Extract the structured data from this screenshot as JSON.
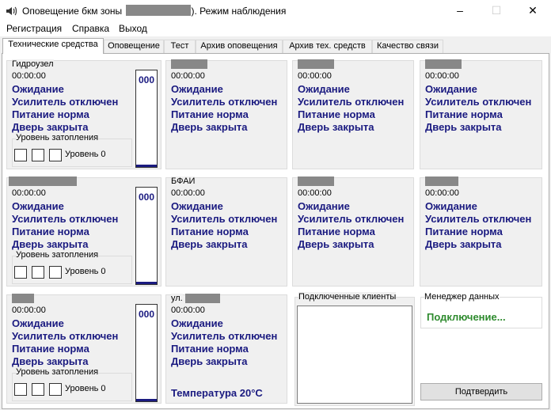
{
  "window": {
    "title_prefix": "Оповещение бкм зоны",
    "title_suffix": "). Режим наблюдения",
    "minimize_glyph": "–",
    "maximize_glyph": "☐",
    "close_glyph": "✕"
  },
  "menu": [
    "Регистрация",
    "Справка",
    "Выход"
  ],
  "tabs": [
    "Технические средства",
    "Оповещение",
    "Тест",
    "Архив оповещения",
    "Архив тех. средств",
    "Качество связи"
  ],
  "active_tab": 0,
  "common": {
    "time": "00:00:00",
    "status_wait": "Ожидание",
    "status_amp": "Усилитель отключен",
    "status_power": "Питание норма",
    "status_door": "Дверь закрыта",
    "flood_label": "Уровень затопления",
    "flood_level": "Уровень 0",
    "gauge_value": "000"
  },
  "panels": {
    "p1": {
      "title": "Гидроузел"
    },
    "p6": {
      "title": "БФАИ"
    },
    "p10": {
      "title": "ул.",
      "temperature": "Температура  20°C"
    }
  },
  "clients": {
    "label": "Подключенные клиенты"
  },
  "data_manager": {
    "label": "Менеджер данных",
    "status": "Подключение...",
    "status_color": "#2e8b2e"
  },
  "confirm_button": "Подтвердить",
  "colors": {
    "status_text": "#1a1a80",
    "redaction": "#888888"
  }
}
